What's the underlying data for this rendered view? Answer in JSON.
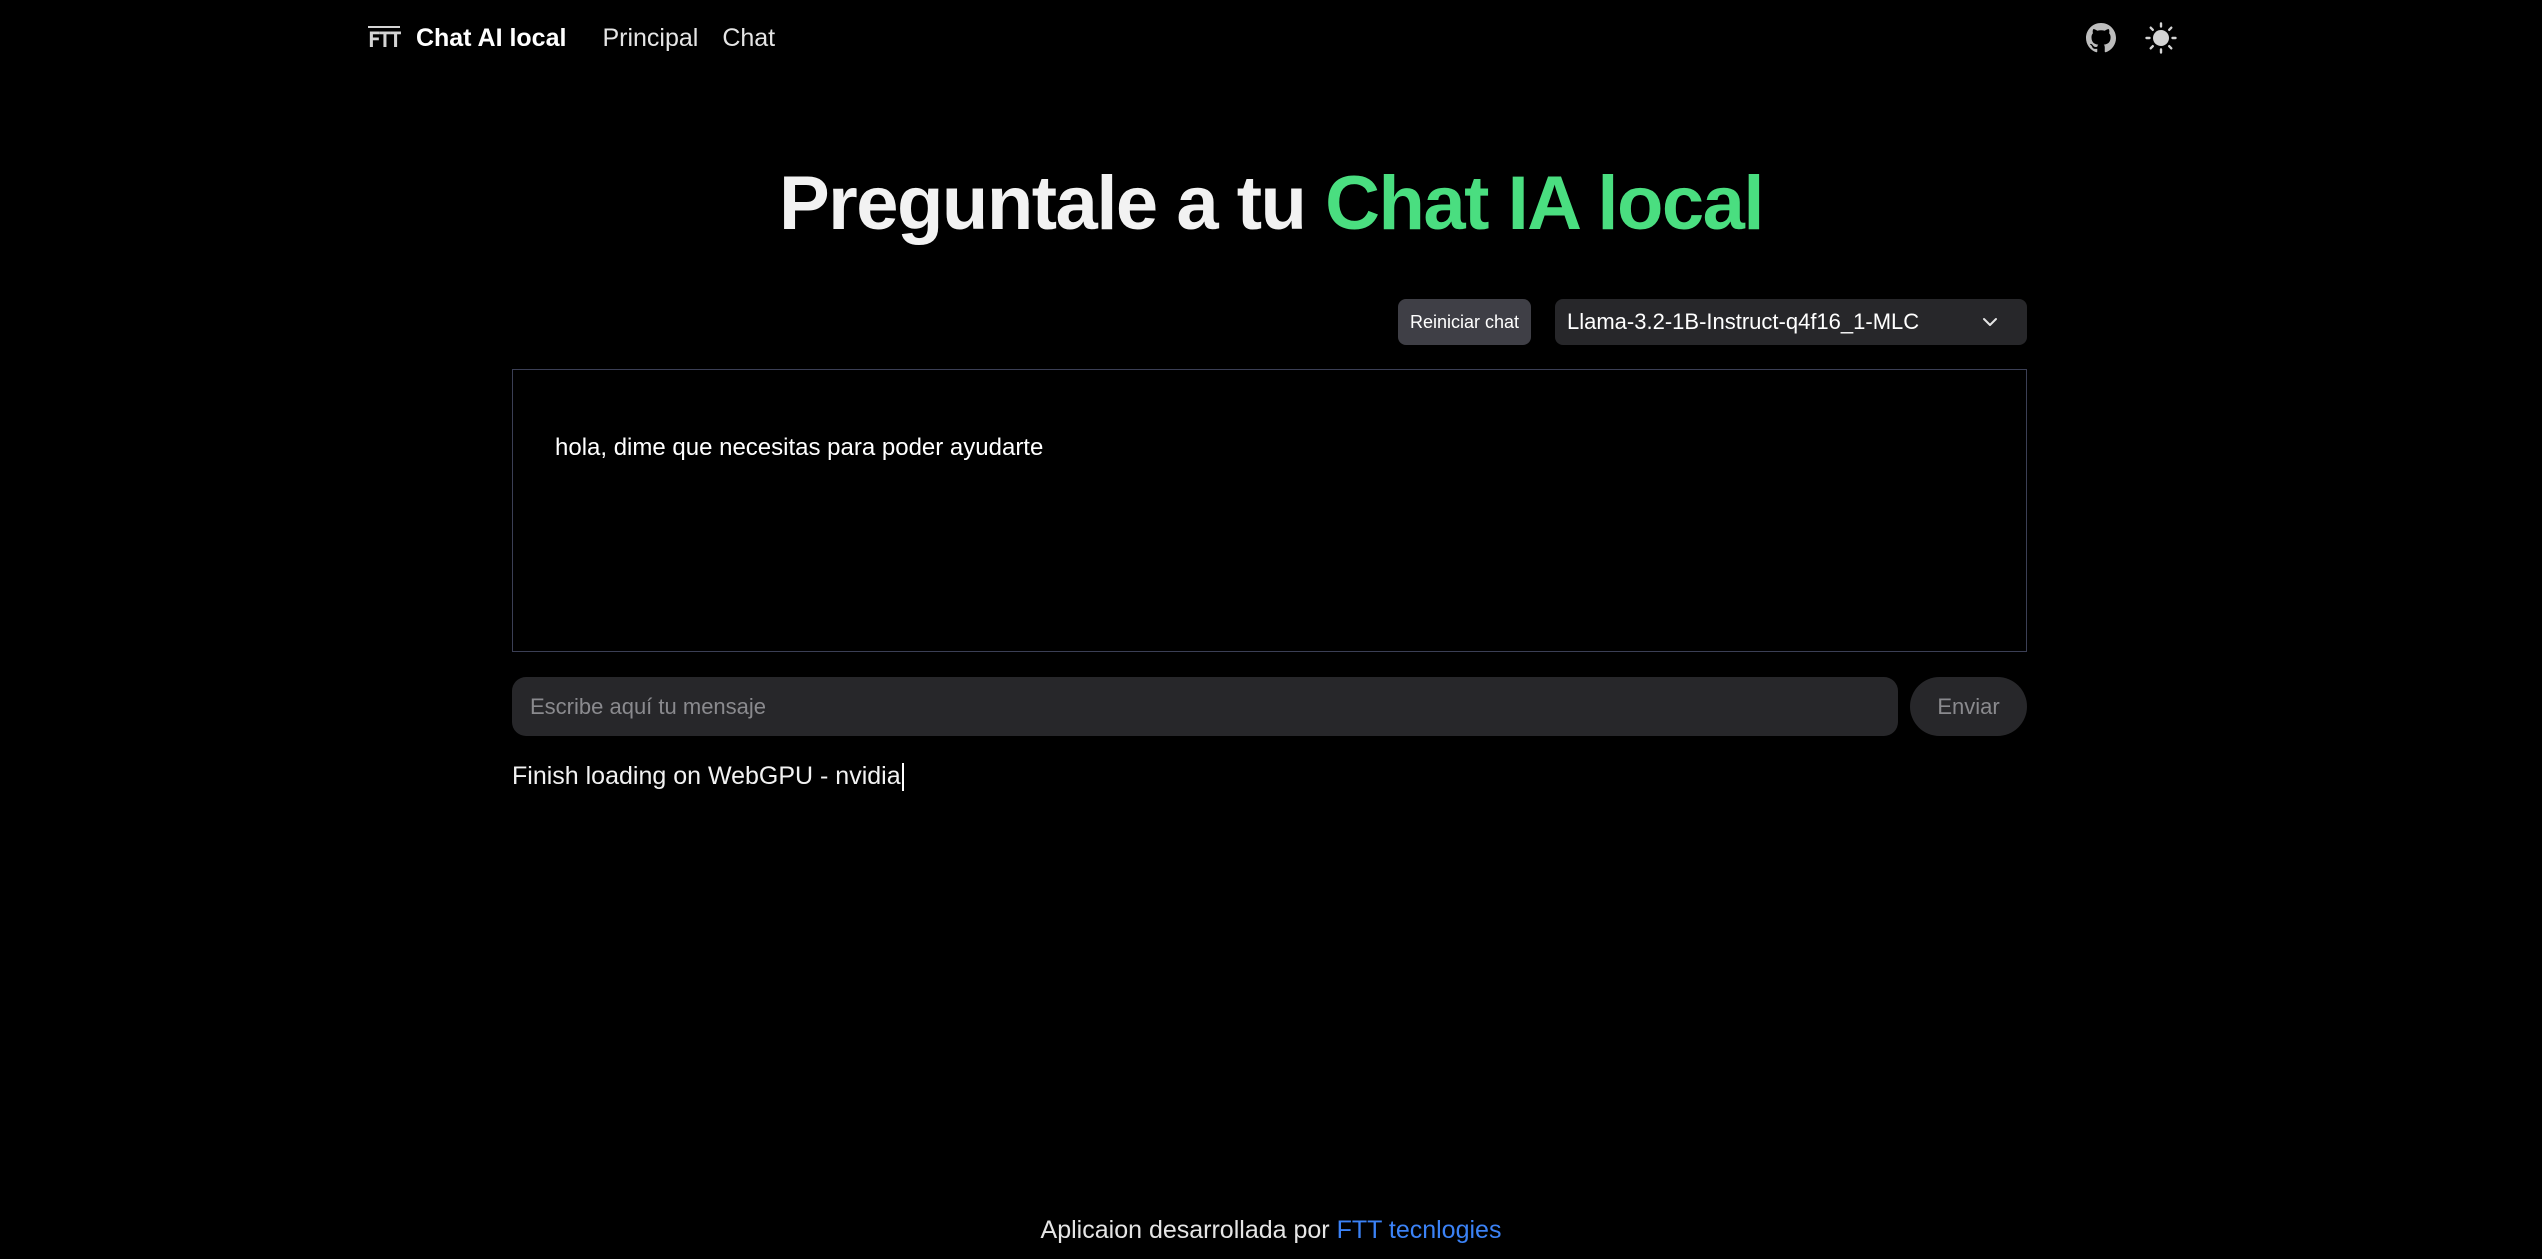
{
  "navbar": {
    "logo_text": "FTT",
    "brand_name": "Chat AI local",
    "links": [
      {
        "label": "Principal"
      },
      {
        "label": "Chat"
      }
    ],
    "github_icon": "github-icon",
    "theme_icon": "sun-icon"
  },
  "hero": {
    "title_plain": "Preguntale a tu",
    "title_accent": "Chat IA local",
    "accent_color": "#4ade80"
  },
  "controls": {
    "reset_label": "Reiniciar chat",
    "model_selected": "Llama-3.2-1B-Instruct-q4f16_1-MLC"
  },
  "chat": {
    "messages": [
      {
        "text": "hola, dime que necesitas para poder ayudarte"
      }
    ]
  },
  "input": {
    "placeholder": "Escribe aquí tu mensaje",
    "value": "",
    "send_label": "Enviar"
  },
  "status": {
    "text": "Finish loading on WebGPU - nvidia"
  },
  "footer": {
    "prefix": "Aplicaion desarrollada por",
    "link_text": "FTT tecnlogies",
    "link_color": "#3b82f6"
  }
}
